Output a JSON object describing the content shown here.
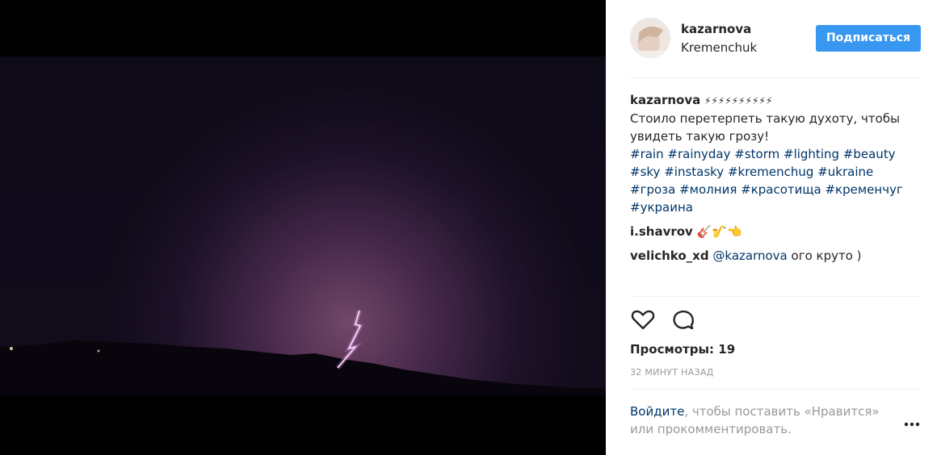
{
  "post": {
    "author": "kazarnova",
    "location": "Kremenchuk",
    "follow_label": "Подписаться"
  },
  "caption": {
    "user": "kazarnova",
    "emoji": "⚡⚡⚡⚡⚡⚡⚡⚡⚡⚡",
    "text": "Стоило перетерпеть такую духоту, чтобы увидеть такую грозу!",
    "tags": [
      "#rain",
      "#rainyday",
      "#storm",
      "#lighting",
      "#beauty",
      "#sky",
      "#instasky",
      "#kremenchug",
      "#ukraine",
      "#гроза",
      "#молния",
      "#красотища",
      "#кременчуг",
      "#украина"
    ]
  },
  "comments": [
    {
      "user": "i.shavrov",
      "mention": "",
      "text": "🎸🎷👈"
    },
    {
      "user": "velichko_xd",
      "mention": "@kazarnova",
      "text": "ого круто )"
    }
  ],
  "stats": {
    "views": "Просмотры: 19",
    "time": "32 МИНУТ НАЗАД"
  },
  "login_prompt": {
    "link": "Войдите",
    "text": ", чтобы поставить «Нравится» или прокомментировать."
  },
  "icons": {
    "like": "heart-icon",
    "comment": "comment-bubble-icon",
    "more": "more-options-icon"
  },
  "colors": {
    "link": "#003569",
    "button": "#3897f0",
    "muted": "#999999"
  }
}
